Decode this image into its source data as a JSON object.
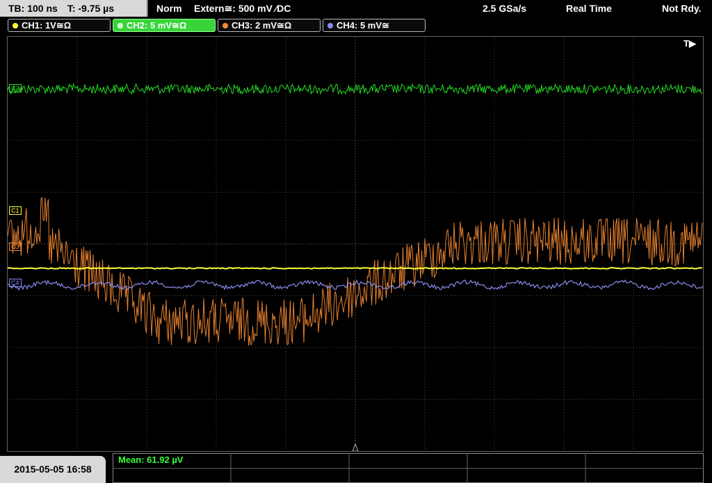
{
  "status": {
    "timebase": "TB: 100 ns",
    "trigger_time": "T: -9.75 µs",
    "mode": "Norm",
    "trigger_source": "Extern≅: 500 mV ⁄DC",
    "sample_rate": "2.5 GSa/s",
    "acq_mode": "Real Time",
    "ready_state": "Not Rdy."
  },
  "channels": [
    {
      "label": "CH1: 1V≅Ω",
      "color": "#ffff33",
      "marker": "C1"
    },
    {
      "label": "CH2: 5 mV≅Ω",
      "color": "#33e033",
      "marker": "C2"
    },
    {
      "label": "CH3: 2 mV≅Ω",
      "color": "#f08a3a",
      "marker": "C3"
    },
    {
      "label": "CH4: 5 mV≅",
      "color": "#8a8aff",
      "marker": "C4"
    }
  ],
  "trigger_marker": "T▶",
  "measurement": {
    "label": "Mean: 61.92 µV"
  },
  "datetime": "2015-05-05 16:58",
  "colors": {
    "grid": "#4a4a4a",
    "ch1": "#ffff33",
    "ch2": "#22dd22",
    "ch3": "#e8822e",
    "ch4": "#8c8cf0"
  }
}
